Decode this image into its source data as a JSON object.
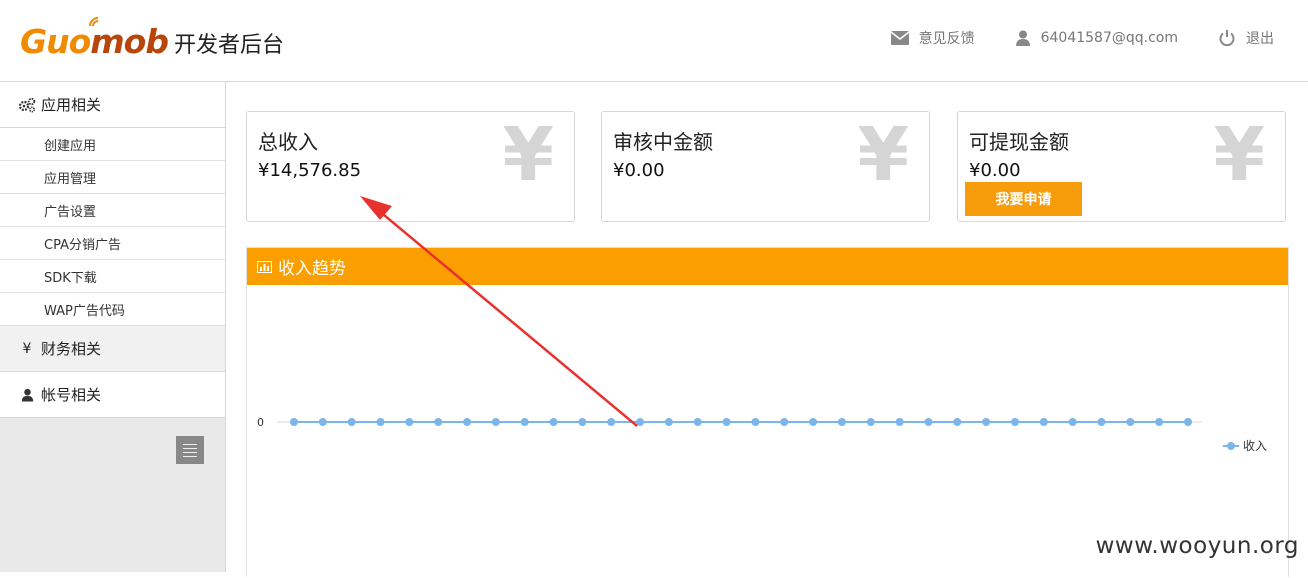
{
  "header": {
    "brand_gu": "Gu",
    "brand_o": "o",
    "brand_mob": "mob",
    "subtitle": "开发者后台",
    "feedback_label": "意见反馈",
    "user_label": "64041587@qq.com",
    "logout_label": "退出"
  },
  "sidebar": {
    "group_app": "应用相关",
    "items": [
      "创建应用",
      "应用管理",
      "广告设置",
      "CPA分销广告",
      "SDK下载",
      "WAP广告代码"
    ],
    "group_finance": "财务相关",
    "group_account": "帐号相关",
    "finance_icon": "¥"
  },
  "cards": {
    "total_title": "总收入",
    "total_value": "¥14,576.85",
    "review_title": "审核中金额",
    "review_value": "¥0.00",
    "withdraw_title": "可提现金额",
    "withdraw_value": "¥0.00",
    "apply_label": "我要申请",
    "yen_glyph": "¥"
  },
  "trend": {
    "title": "收入趋势"
  },
  "chart_data": {
    "type": "line",
    "series": [
      {
        "name": "收入",
        "values": [
          0,
          0,
          0,
          0,
          0,
          0,
          0,
          0,
          0,
          0,
          0,
          0,
          0,
          0,
          0,
          0,
          0,
          0,
          0,
          0,
          0,
          0,
          0,
          0,
          0,
          0,
          0,
          0,
          0,
          0,
          0,
          0
        ]
      }
    ],
    "yticks": [
      "0"
    ],
    "legend_position": "right",
    "color": "#7cb5ec"
  },
  "watermark": "www.wooyun.org",
  "colors": {
    "accent": "#fb9e00",
    "annotation_arrow": "#e8322f"
  }
}
